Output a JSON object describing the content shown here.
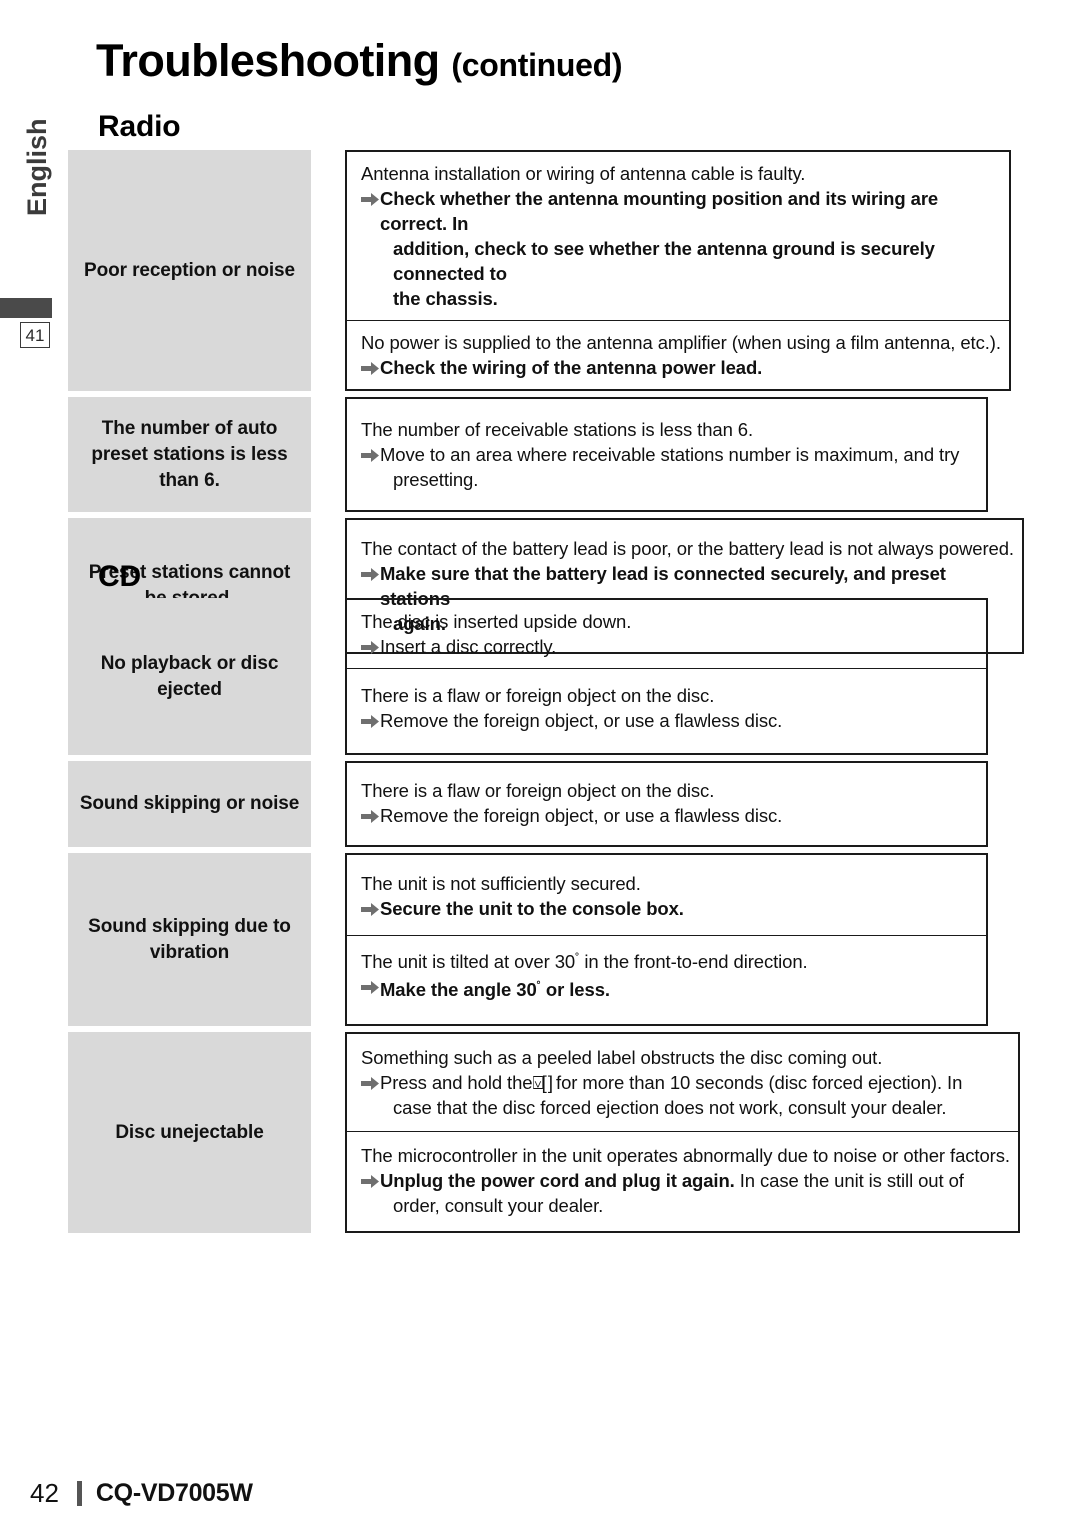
{
  "page": {
    "title_main": "Troubleshooting",
    "title_continued": "(continued)",
    "language_tab": "English",
    "side_page_number": "41",
    "footer_page_number": "42",
    "footer_model": "CQ-VD7005W",
    "arrow_icon": "right-arrow-icon",
    "colors": {
      "cause_cell_bg": "#d9d9d9",
      "border": "#1a1a1a",
      "arrow": "#6f6f6f",
      "sidebar_text": "#3b3b3b",
      "sidebar_bar": "#4a4a4a"
    }
  },
  "sections": [
    {
      "heading": "Radio",
      "rows": [
        {
          "cause": "Poor reception or noise",
          "blocks": [
            {
              "problem": "Antenna installation or wiring of antenna cable is faulty.",
              "solution_bold": true,
              "solution_lines": [
                "Check whether the antenna mounting position and its wiring are correct. In",
                "addition, check to see whether the antenna ground is securely connected to",
                "the chassis."
              ]
            },
            {
              "problem": "No power is supplied to the antenna amplifier (when using a film antenna, etc.).",
              "solution_bold": true,
              "solution_lines": [
                "Check the wiring of the antenna power lead."
              ]
            }
          ]
        },
        {
          "cause": "The number of auto preset stations is less than 6.",
          "cause_lines": [
            "The number of auto",
            "preset stations is less",
            "than 6."
          ],
          "blocks": [
            {
              "problem": "The number of receivable stations is less than 6.",
              "solution_bold": false,
              "solution_lines": [
                "Move to an area where receivable stations number is maximum, and try",
                "presetting."
              ]
            }
          ]
        },
        {
          "cause": "Preset stations cannot be stored.",
          "cause_lines": [
            "Preset stations cannot",
            "be stored."
          ],
          "blocks": [
            {
              "problem": "The contact of the battery lead is poor, or the battery lead is not always powered.",
              "solution_bold": true,
              "solution_lines": [
                "Make sure that the battery lead is connected securely, and preset stations",
                "again."
              ]
            }
          ]
        }
      ]
    },
    {
      "heading": "CD",
      "rows": [
        {
          "cause": "No playback or disc ejected",
          "cause_lines": [
            "No playback or disc",
            "ejected"
          ],
          "blocks": [
            {
              "problem": "The disc is inserted upside down.",
              "solution_bold": false,
              "solution_lines": [
                "Insert a disc correctly."
              ]
            },
            {
              "problem": "There is a flaw or foreign object on the disc.",
              "solution_bold": false,
              "solution_lines": [
                "Remove the foreign object, or use a flawless disc."
              ]
            }
          ]
        },
        {
          "cause": "Sound skipping or noise",
          "cause_lines": [
            "Sound skipping or noise"
          ],
          "blocks": [
            {
              "problem": "There is a flaw or foreign object on the disc.",
              "solution_bold": false,
              "solution_lines": [
                "Remove the foreign object, or use a flawless disc."
              ]
            }
          ]
        },
        {
          "cause": "Sound skipping due to vibration",
          "cause_lines": [
            "Sound skipping due to",
            "vibration"
          ],
          "blocks": [
            {
              "problem": "The unit is not sufficiently secured.",
              "solution_bold": true,
              "solution_lines": [
                "Secure the unit to the console box."
              ]
            },
            {
              "problem": "The unit is tilted at over 30˚ in the front-to-end direction.",
              "solution_bold": true,
              "solution_lines": [
                "Make the angle 30˚ or less."
              ]
            }
          ]
        },
        {
          "cause": "Disc unejectable",
          "cause_lines": [
            "Disc unejectable"
          ],
          "blocks": [
            {
              "problem": "Something such as a peeled label obstructs the disc coming out.",
              "solution_bold": false,
              "solution_lines": [
                "Press and hold the⍌[ ] for more than 10 seconds (disc forced ejection). In",
                "case that the disc forced ejection does not work, consult your dealer."
              ]
            },
            {
              "problem": "The microcontroller in the unit operates abnormally due to noise or other factors.",
              "solution_bold": false,
              "solution_lines": [
                "Unplug the power cord and plug it again. In case the unit is still out of",
                "order, consult your dealer."
              ]
            }
          ]
        }
      ]
    }
  ],
  "radio": {
    "r1": {
      "cause": "Poor reception or noise",
      "b1p": "Antenna installation or wiring of antenna cable is faulty.",
      "b1s1": "Check whether the antenna mounting position and its wiring are correct. In",
      "b1s2": "addition, check to see whether the antenna ground is securely connected to",
      "b1s3": "the chassis.",
      "b2p": "No power is supplied to the antenna amplifier (when using a film antenna, etc.).",
      "b2s1": "Check the wiring of the antenna power lead."
    },
    "r2": {
      "c1": "The number of auto",
      "c2": "preset stations is less",
      "c3": "than 6.",
      "b1p": "The number of receivable stations is less than 6.",
      "b1s1": "Move to an area where receivable stations number is maximum, and try",
      "b1s2": "presetting."
    },
    "r3": {
      "c1": "Preset stations cannot",
      "c2": "be stored.",
      "b1p": "The contact of the battery lead is poor, or the battery lead is not always powered.",
      "b1s1": "Make sure that the battery lead is connected securely, and preset stations",
      "b1s2": "again."
    }
  },
  "cd": {
    "r1": {
      "c1": "No playback or disc",
      "c2": "ejected",
      "b1p": "The disc is inserted upside down.",
      "b1s1": "Insert a disc correctly.",
      "b2p": "There is a flaw or foreign object on the disc.",
      "b2s1": "Remove the foreign object, or use a flawless disc."
    },
    "r2": {
      "c1": "Sound skipping or noise",
      "b1p": "There is a flaw or foreign object on the disc.",
      "b1s1": "Remove the foreign object, or use a flawless disc."
    },
    "r3": {
      "c1": "Sound skipping due to",
      "c2": "vibration",
      "b1p": "The unit is not sufficiently secured.",
      "b1s1": "Secure the unit to the console box.",
      "b2p_a": "The unit is tilted at over 30",
      "b2p_deg": "˚",
      "b2p_b": " in the front-to-end direction.",
      "b2s1_a": "Make the angle 30",
      "b2s1_deg": "˚",
      "b2s1_b": " or less."
    },
    "r4": {
      "c1": "Disc unejectable",
      "b1p": "Something such as a peeled label obstructs the disc coming out.",
      "b1s1_a": "Press and hold the",
      "b1s1_glyph": "⍌[ ]",
      "b1s1_b": " for more than 10 seconds (disc forced ejection). In",
      "b1s2": "case that the disc forced ejection does not work, consult your dealer.",
      "b2p": "The microcontroller in the unit operates abnormally due to noise or other factors.",
      "b2s1_bold": "Unplug the power cord and plug it again.",
      "b2s1_rest": " In case the unit is still out of",
      "b2s2": "order, consult your dealer."
    }
  }
}
